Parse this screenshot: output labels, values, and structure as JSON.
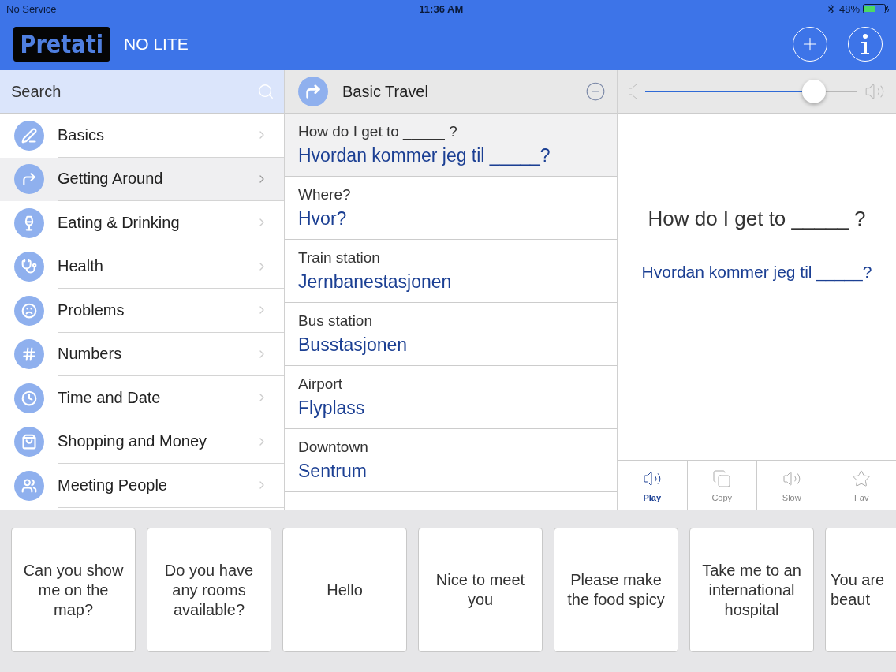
{
  "status_bar": {
    "carrier": "No Service",
    "time": "11:36 AM",
    "battery": "48%"
  },
  "header": {
    "logo": "Pretati",
    "subtitle": "NO LITE"
  },
  "search": {
    "placeholder": "Search"
  },
  "categories": [
    {
      "label": "Basics",
      "selected": false
    },
    {
      "label": "Getting Around",
      "selected": true
    },
    {
      "label": "Eating & Drinking",
      "selected": false
    },
    {
      "label": "Health",
      "selected": false
    },
    {
      "label": "Problems",
      "selected": false
    },
    {
      "label": "Numbers",
      "selected": false
    },
    {
      "label": "Time and Date",
      "selected": false
    },
    {
      "label": "Shopping and Money",
      "selected": false
    },
    {
      "label": "Meeting People",
      "selected": false
    }
  ],
  "phrase_list": {
    "title": "Basic Travel",
    "items": [
      {
        "english": "How do I get to _____ ?",
        "translation": "Hvordan kommer jeg til _____?",
        "selected": true
      },
      {
        "english": "Where?",
        "translation": "Hvor?",
        "selected": false
      },
      {
        "english": "Train station",
        "translation": "Jernbanestasjonen",
        "selected": false
      },
      {
        "english": "Bus station",
        "translation": "Busstasjonen",
        "selected": false
      },
      {
        "english": "Airport",
        "translation": "Flyplass",
        "selected": false
      },
      {
        "english": "Downtown",
        "translation": "Sentrum",
        "selected": false
      }
    ]
  },
  "detail": {
    "volume": {
      "level": 0.8
    },
    "english": "How do I get to _____ ?",
    "translation": "Hvordan kommer jeg til _____?",
    "actions": [
      {
        "label": "Play",
        "kind": "play",
        "selected": true
      },
      {
        "label": "Copy",
        "kind": "copy",
        "selected": false
      },
      {
        "label": "Slow",
        "kind": "slow",
        "selected": false
      },
      {
        "label": "Fav",
        "kind": "fav",
        "selected": false
      }
    ]
  },
  "quick_phrases": [
    "Can you show me on the map?",
    "Do you have any rooms available?",
    "Hello",
    "Nice to meet you",
    "Please make the food spicy",
    "Take me to an international hospital",
    "You are beaut"
  ]
}
